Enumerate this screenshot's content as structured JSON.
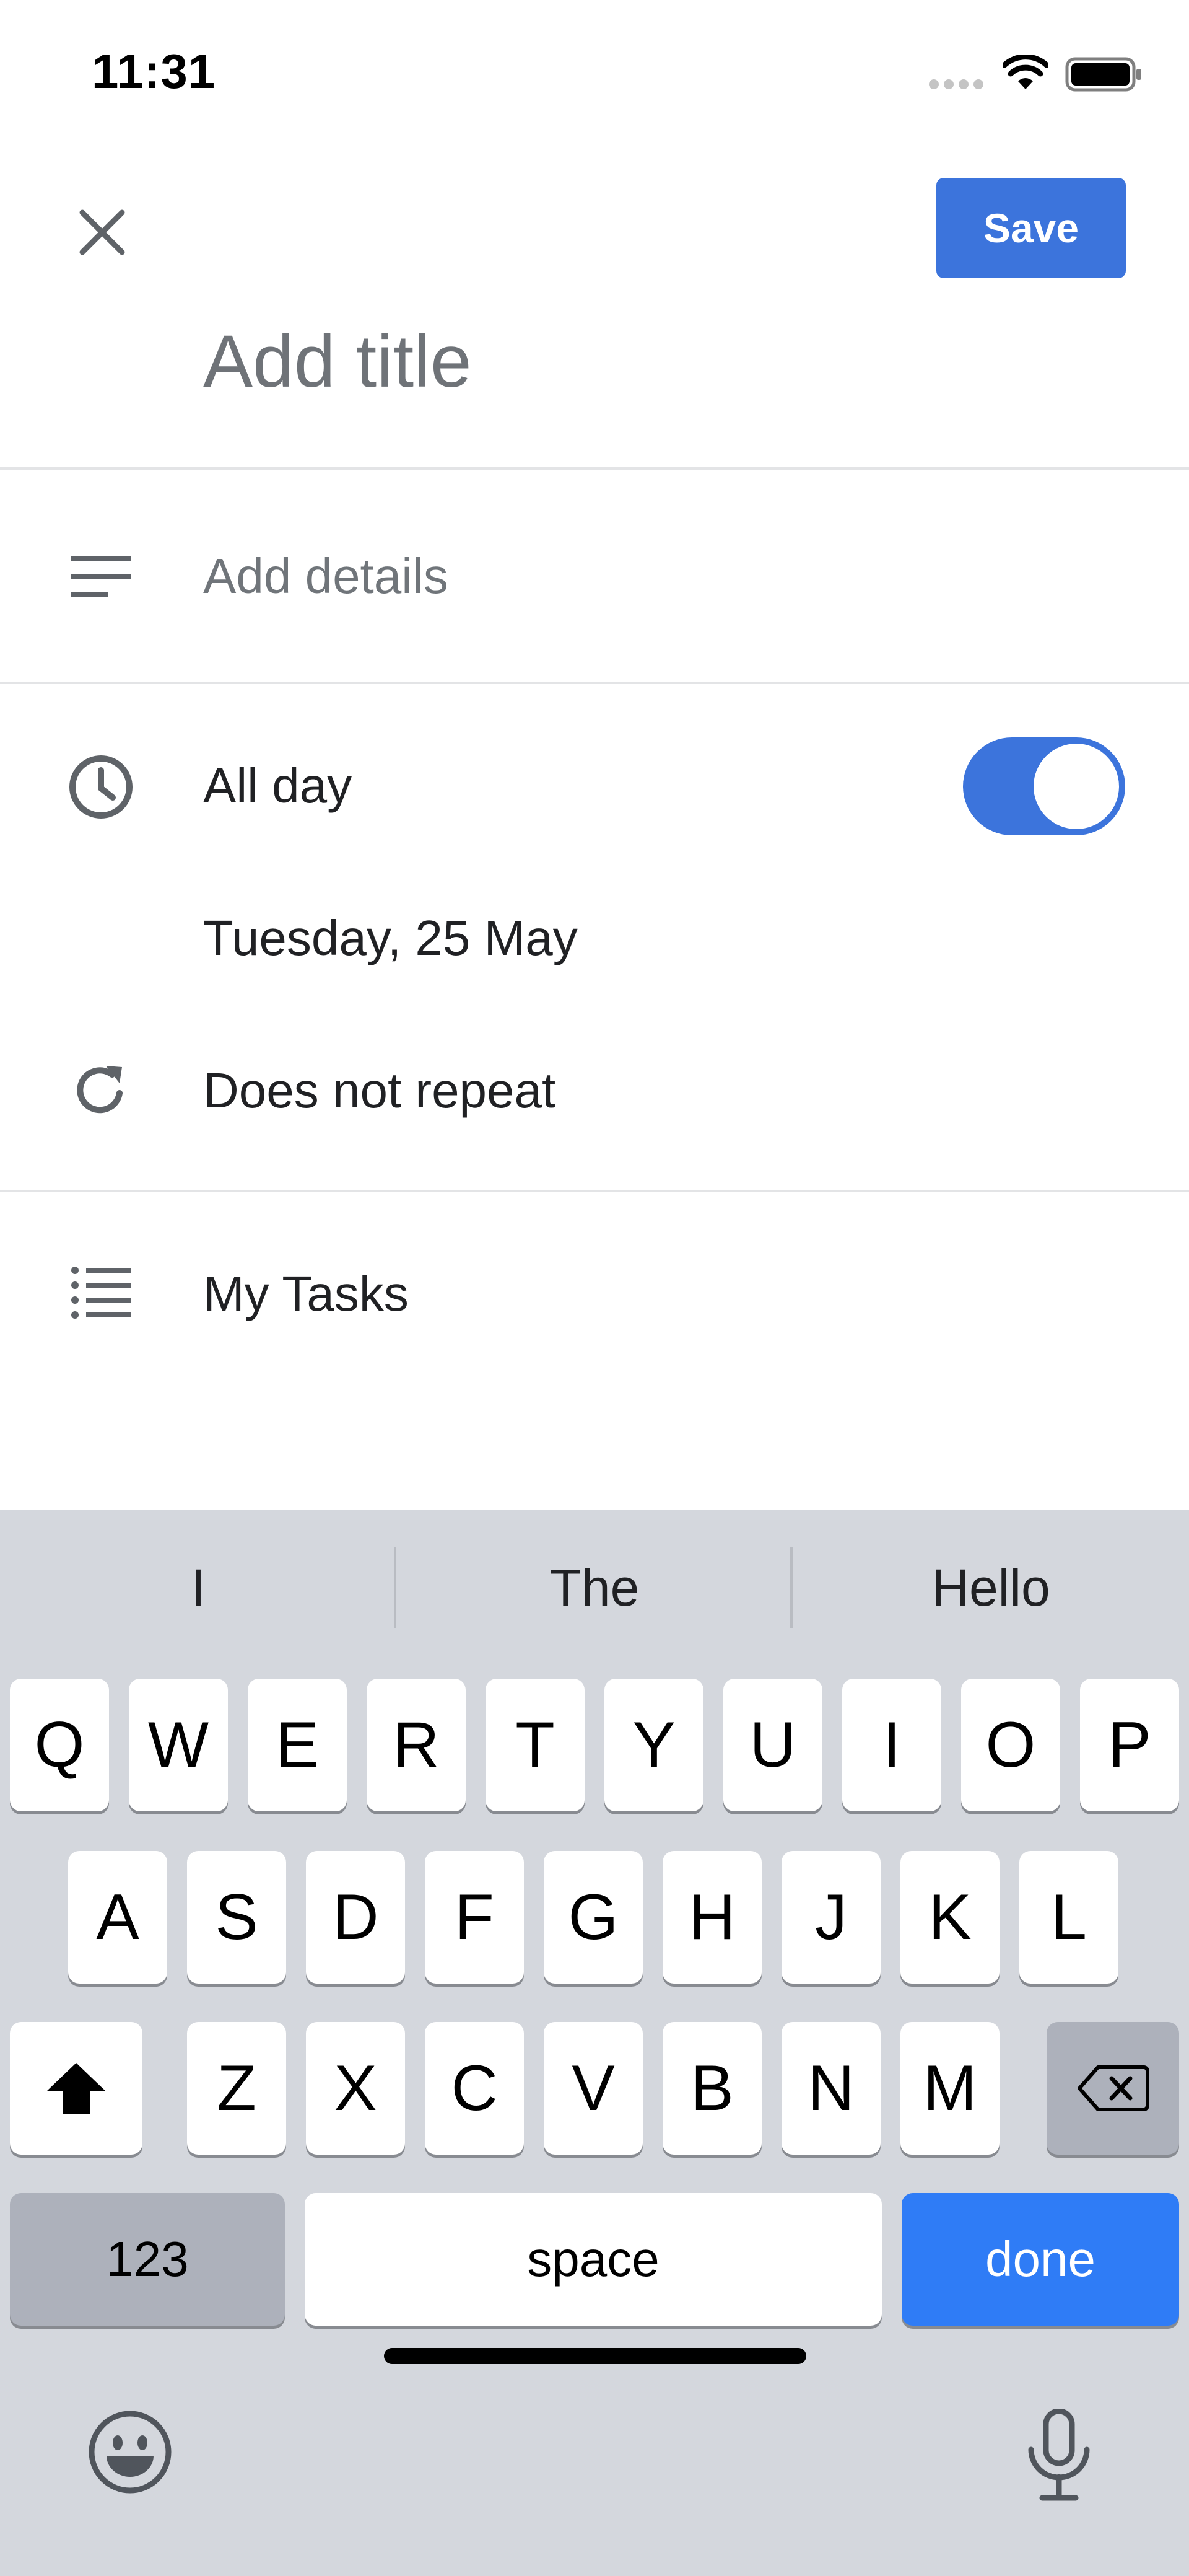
{
  "status_bar": {
    "time": "11:31"
  },
  "header": {
    "save_label": "Save",
    "title_placeholder": "Add title"
  },
  "details": {
    "placeholder": "Add details"
  },
  "schedule": {
    "all_day_label": "All day",
    "all_day_enabled": true,
    "date": "Tuesday, 25 May",
    "repeat": "Does not repeat"
  },
  "task_list": {
    "name": "My Tasks"
  },
  "keyboard": {
    "suggestions": [
      "I",
      "The",
      "Hello"
    ],
    "row1": [
      "Q",
      "W",
      "E",
      "R",
      "T",
      "Y",
      "U",
      "I",
      "O",
      "P"
    ],
    "row2": [
      "A",
      "S",
      "D",
      "F",
      "G",
      "H",
      "J",
      "K",
      "L"
    ],
    "row3": [
      "Z",
      "X",
      "C",
      "V",
      "B",
      "N",
      "M"
    ],
    "numbers_label": "123",
    "space_label": "space",
    "done_label": "done"
  },
  "colors": {
    "accent": "#3c74dc",
    "done_key": "#2f7cf6",
    "keyboard_bg": "#d4d7dd"
  }
}
